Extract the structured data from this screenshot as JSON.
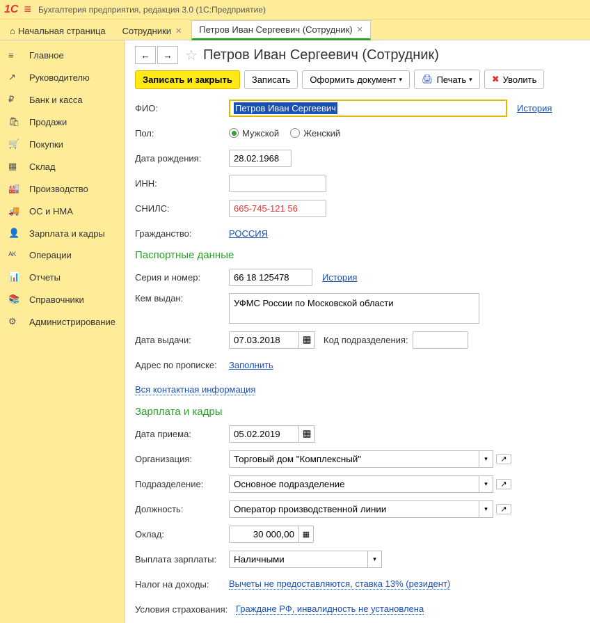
{
  "app_title": "Бухгалтерия предприятия, редакция 3.0  (1С:Предприятие)",
  "tabs": {
    "home": "Начальная страница",
    "t1": "Сотрудники",
    "t2": "Петров Иван Сергеевич (Сотрудник)"
  },
  "sidebar": [
    {
      "icon": "≡",
      "label": "Главное"
    },
    {
      "icon": "↗",
      "label": "Руководителю"
    },
    {
      "icon": "₽",
      "label": "Банк и касса"
    },
    {
      "icon": "🛍",
      "label": "Продажи"
    },
    {
      "icon": "🛒",
      "label": "Покупки"
    },
    {
      "icon": "▦",
      "label": "Склад"
    },
    {
      "icon": "🏭",
      "label": "Производство"
    },
    {
      "icon": "🚚",
      "label": "ОС и НМА"
    },
    {
      "icon": "👤",
      "label": "Зарплата и кадры"
    },
    {
      "icon": "ᴬᴷ",
      "label": "Операции"
    },
    {
      "icon": "📊",
      "label": "Отчеты"
    },
    {
      "icon": "📚",
      "label": "Справочники"
    },
    {
      "icon": "⚙",
      "label": "Администрирование"
    }
  ],
  "page_title": "Петров Иван Сергеевич (Сотрудник)",
  "toolbar": {
    "save_close": "Записать и закрыть",
    "save": "Записать",
    "doc": "Оформить документ",
    "print": "Печать",
    "fire": "Уволить"
  },
  "form": {
    "fio_label": "ФИО:",
    "fio_value": "Петров Иван Сергеевич",
    "fio_history": "История",
    "gender_label": "Пол:",
    "gender_male": "Мужской",
    "gender_female": "Женский",
    "dob_label": "Дата рождения:",
    "dob_value": "28.02.1968",
    "inn_label": "ИНН:",
    "inn_value": "",
    "snils_label": "СНИЛС:",
    "snils_value": "665-745-121 56",
    "citizenship_label": "Гражданство:",
    "citizenship_value": "РОССИЯ"
  },
  "passport": {
    "title": "Паспортные данные",
    "serial_label": "Серия и номер:",
    "serial_value": "66 18 125478",
    "serial_history": "История",
    "issued_by_label": "Кем выдан:",
    "issued_by_value": "УФМС России по Московской области",
    "issue_date_label": "Дата выдачи:",
    "issue_date_value": "07.03.2018",
    "dept_code_label": "Код подразделения:",
    "dept_code_value": "",
    "address_label": "Адрес по прописке:",
    "address_fill": "Заполнить",
    "contact_info": "Вся контактная информация"
  },
  "hr": {
    "title": "Зарплата и кадры",
    "hire_date_label": "Дата приема:",
    "hire_date_value": "05.02.2019",
    "org_label": "Организация:",
    "org_value": "Торговый дом \"Комплексный\"",
    "dept_label": "Подразделение:",
    "dept_value": "Основное подразделение",
    "position_label": "Должность:",
    "position_value": "Оператор производственной линии",
    "salary_label": "Оклад:",
    "salary_value": "30 000,00",
    "payment_label": "Выплата зарплаты:",
    "payment_value": "Наличными",
    "tax_label": "Налог на доходы:",
    "tax_value": "Вычеты не предоставляются, ставка 13% (резидент)",
    "insurance_label": "Условия страхования:",
    "insurance_value": "Граждане РФ, инвалидность не установлена"
  }
}
